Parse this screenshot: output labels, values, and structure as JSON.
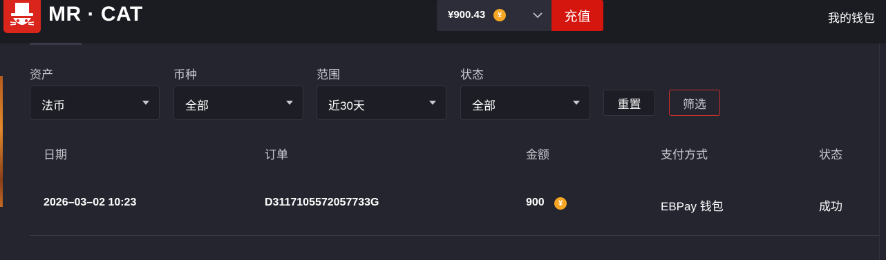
{
  "header": {
    "brand": "MR · CAT",
    "balance": "¥900.43",
    "coin_symbol": "¥",
    "topup_label": "充值",
    "wallet_label": "我的钱包"
  },
  "filters": [
    {
      "label": "资产",
      "value": "法币"
    },
    {
      "label": "币种",
      "value": "全部"
    },
    {
      "label": "范围",
      "value": "近30天"
    },
    {
      "label": "状态",
      "value": "全部"
    }
  ],
  "buttons": {
    "reset": "重置",
    "filter": "筛选"
  },
  "table": {
    "columns": [
      "日期",
      "订单",
      "金额",
      "支付方式",
      "状态"
    ],
    "rows": [
      {
        "date": "2026–03–02 10:23",
        "order": "D3117105572057733G",
        "amount": "900",
        "coin_symbol": "¥",
        "payment": "EBPay 钱包",
        "status": "成功"
      }
    ]
  },
  "colors": {
    "accent": "#d5160f",
    "coin": "#f5a623",
    "background": "#24252f",
    "header": "#1b1c22"
  },
  "icons": [
    "cat-logo-icon",
    "coin-icon",
    "chevron-down-icon",
    "caret-down-icon"
  ]
}
